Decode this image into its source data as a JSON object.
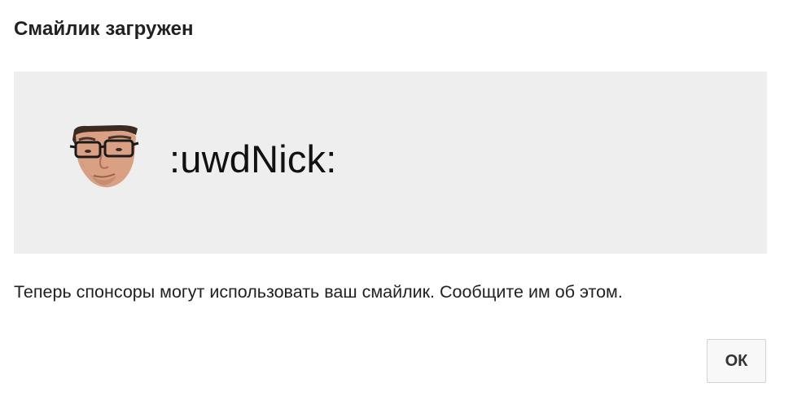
{
  "dialog": {
    "title": "Смайлик загружен",
    "emoji": {
      "icon": "face-emoji-icon",
      "code": ":uwdNick:"
    },
    "message": "Теперь спонсоры могут использовать ваш смайлик. Сообщите им об этом.",
    "ok_label": "ОК"
  },
  "colors": {
    "preview_background": "#eeeeee",
    "text": "#212121",
    "button_background": "#f8f8f8",
    "button_border": "#d3d3d3"
  }
}
